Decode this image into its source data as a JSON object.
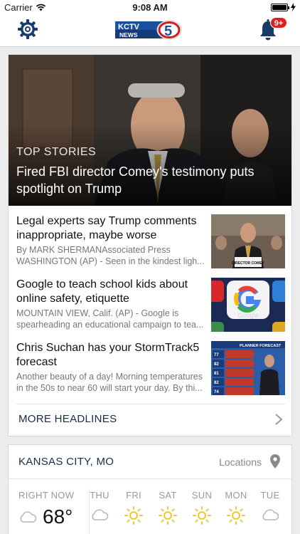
{
  "status_bar": {
    "carrier": "Carrier",
    "time": "9:08 AM"
  },
  "header": {
    "notification_count": "9+",
    "logo_text": "KCTV",
    "logo_sub": "NEWS",
    "logo_number": "5"
  },
  "hero": {
    "overline": "TOP STORIES",
    "title": "Fired FBI director Comey's testimony puts spotlight on Trump"
  },
  "stories": [
    {
      "headline": "Legal experts say Trump comments inappropriate, maybe worse",
      "summary": "By MARK SHERMANAssociated Press WASHINGTON (AP) - Seen in the kindest ligh...",
      "thumb_text": "DIRECTOR COMEY"
    },
    {
      "headline": "Google to teach school kids about online safety, etiquette",
      "summary": "MOUNTAIN VIEW, Calif. (AP) - Google is spearheading an educational campaign to tea...",
      "thumb_text": "Google"
    },
    {
      "headline": "Chris Suchan has your StormTrack5 forecast",
      "summary": "Another beauty of a day! Morning temperatures in the 50s to near 60 will start your day. By thi...",
      "thumb_text": "PLANNER FORECAST"
    }
  ],
  "more_headlines": "MORE HEADLINES",
  "weather": {
    "city": "KANSAS CITY, MO",
    "locations_label": "Locations",
    "now_label": "RIGHT NOW",
    "now_temp": "68°",
    "now_icon": "cloud-icon",
    "days": [
      {
        "label": "THU",
        "icon": "cloud-icon"
      },
      {
        "label": "FRI",
        "icon": "sun-icon"
      },
      {
        "label": "SAT",
        "icon": "sun-icon"
      },
      {
        "label": "SUN",
        "icon": "sun-icon"
      },
      {
        "label": "MON",
        "icon": "sun-icon"
      },
      {
        "label": "TUE",
        "icon": "cloud-icon"
      }
    ]
  },
  "colors": {
    "accent_navy": "#1a3a6a",
    "badge_red": "#e02020",
    "sun_yellow": "#f2c230"
  }
}
